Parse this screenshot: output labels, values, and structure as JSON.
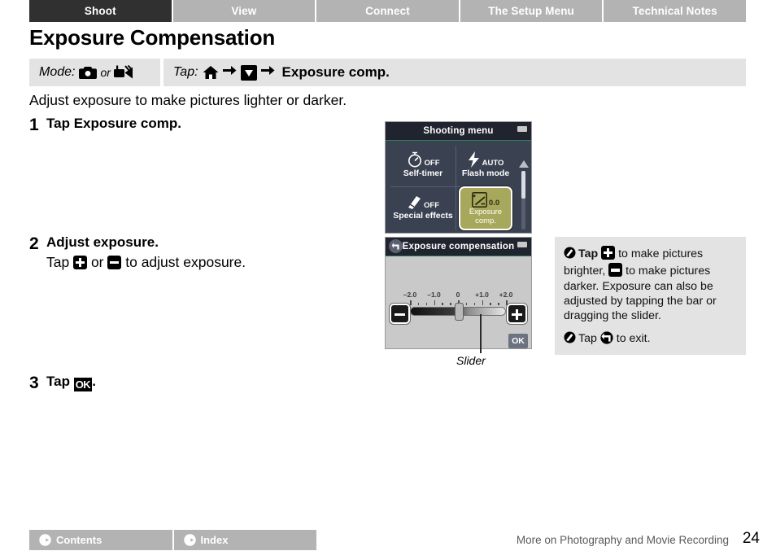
{
  "tabs": [
    {
      "label": "Shoot",
      "active": true
    },
    {
      "label": "View",
      "active": false
    },
    {
      "label": "Connect",
      "active": false
    },
    {
      "label": "The Setup Menu",
      "active": false
    },
    {
      "label": "Technical Notes",
      "active": false
    }
  ],
  "page_title": "Exposure Compensation",
  "mode_bar": {
    "mode_label": "Mode:",
    "mode_icon_1": "still-camera-icon",
    "or_label": "or",
    "mode_icon_2": "movie-camera-icon",
    "tap_label": "Tap:",
    "tap_icon_1": "home-icon",
    "tap_icon_2": "menu-down-triangle-icon",
    "arrow": "→",
    "tap_target": "Exposure comp."
  },
  "intro": "Adjust exposure to make pictures lighter or darker.",
  "steps": [
    {
      "num": "1",
      "head_prefix": "Tap ",
      "head_bold": "Exposure comp.",
      "head_suffix": "",
      "sub": ""
    },
    {
      "num": "2",
      "head_prefix": "",
      "head_bold": "Adjust exposure.",
      "head_suffix": "",
      "sub_pre": "Tap ",
      "sub_mid": " or ",
      "sub_post": " to adjust exposure."
    },
    {
      "num": "3",
      "head_prefix": "Tap ",
      "head_bold": "",
      "head_suffix": ".",
      "ok_glyph": "OK"
    }
  ],
  "lcd_menu": {
    "title": "Shooting menu",
    "battery_icon": "battery-icon",
    "items": [
      {
        "label": "Self-timer",
        "value": "OFF",
        "icon": "self-timer-icon"
      },
      {
        "label": "Flash mode",
        "value": "AUTO",
        "icon": "flash-icon"
      },
      {
        "label": "Special effects",
        "value": "OFF",
        "icon": "special-effects-icon"
      }
    ],
    "highlighted": {
      "label_line1": "Exposure",
      "label_line2": "comp.",
      "value": "0.0",
      "icon": "exposure-comp-icon"
    },
    "scroll_up_icon": "scroll-up-arrow-icon",
    "scroll_down_icon": "scroll-down-arrow-icon"
  },
  "lcd_exposure": {
    "title": "Exposure compensation",
    "back_icon": "back-arrow-icon",
    "battery_icon": "battery-icon",
    "minus_button": "minus-button",
    "plus_button": "plus-button",
    "ok_button": "OK",
    "scale_labels": [
      "–2.0",
      "–1.0",
      "0",
      "+1.0",
      "+2.0"
    ],
    "scale_values": [
      -2.0,
      -1.0,
      0,
      1.0,
      2.0
    ],
    "slider_value": "0.0"
  },
  "callout": {
    "label": "Slider"
  },
  "note": {
    "icon": "pencil-note-icon",
    "p1_bold": "Tap",
    "p1_a": " to make pictures brighter, ",
    "p1_b": " to make pictures darker. Exposure can also be adjusted by tapping the bar or dragging the slider.",
    "p2_a": "Tap ",
    "p2_b": " to exit.",
    "p2_icon": "back-arrow-icon"
  },
  "footer": {
    "buttons": [
      {
        "label": "Contents",
        "icon": "arrow-right-circle-icon"
      },
      {
        "label": "Index",
        "icon": "arrow-right-circle-icon"
      }
    ],
    "section": "More on Photography and Movie Recording",
    "page_number": "24"
  }
}
